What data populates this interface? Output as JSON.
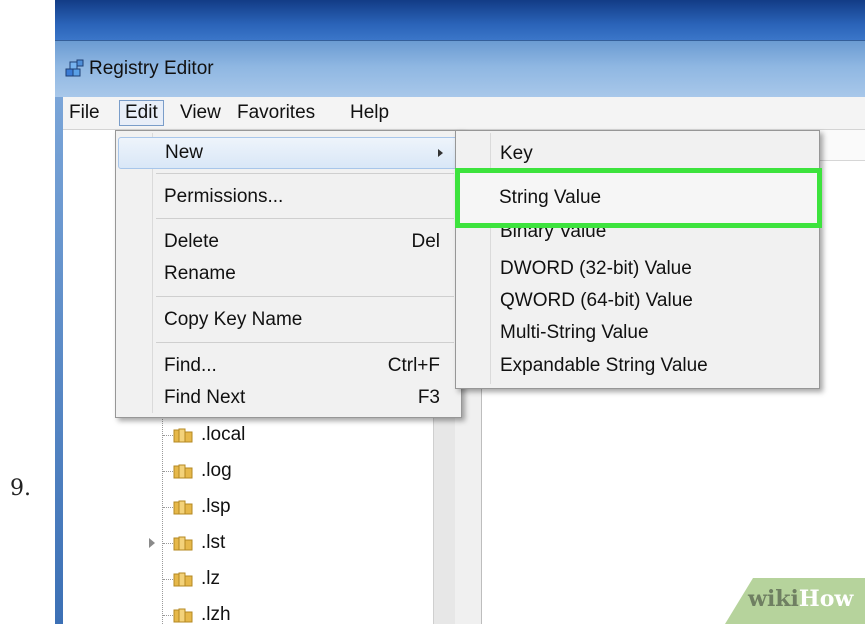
{
  "step": {
    "number": "9."
  },
  "window": {
    "title": "Registry Editor"
  },
  "menubar": {
    "items": [
      "File",
      "Edit",
      "View",
      "Favorites",
      "Help"
    ]
  },
  "edit_menu": {
    "new": "New",
    "permissions": "Permissions...",
    "delete": "Delete",
    "delete_shortcut": "Del",
    "rename": "Rename",
    "copy_key_name": "Copy Key Name",
    "find": "Find...",
    "find_shortcut": "Ctrl+F",
    "find_next": "Find Next",
    "find_next_shortcut": "F3"
  },
  "new_submenu": {
    "items": [
      "Key",
      "String Value",
      "Binary Value",
      "DWORD (32-bit) Value",
      "QWORD (64-bit) Value",
      "Multi-String Value",
      "Expandable String Value"
    ]
  },
  "tree": {
    "items": [
      ".local",
      ".log",
      ".lsp",
      ".lst",
      ".lz",
      ".lzh"
    ]
  },
  "watermark": {
    "wiki": "wiki",
    "how": "How"
  },
  "colors": {
    "highlight": "#3de33d",
    "titlebar": "#8fb7e2"
  }
}
